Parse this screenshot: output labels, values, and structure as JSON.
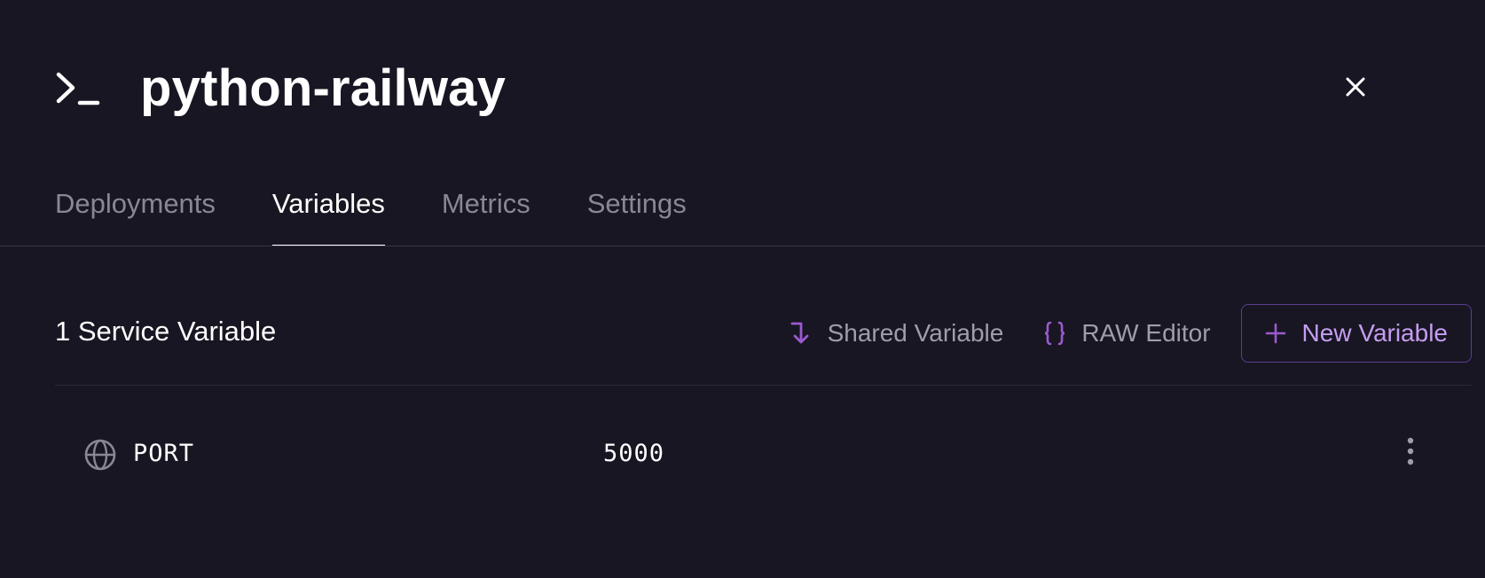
{
  "header": {
    "title": "python-railway",
    "service_icon": "terminal-icon",
    "close_icon": "close-icon"
  },
  "tabs": [
    {
      "label": "Deployments",
      "active": false
    },
    {
      "label": "Variables",
      "active": true
    },
    {
      "label": "Metrics",
      "active": false
    },
    {
      "label": "Settings",
      "active": false
    }
  ],
  "toolbar": {
    "count_title": "1 Service Variable",
    "shared_variable_label": "Shared Variable",
    "raw_editor_label": "RAW Editor",
    "new_variable_label": "New Variable"
  },
  "variables": [
    {
      "name": "PORT",
      "value": "5000",
      "icon": "globe-icon"
    }
  ],
  "colors": {
    "background": "#181622",
    "accent": "#9b59d0",
    "accent_text": "#c59df2",
    "muted_text": "#8a8794"
  }
}
